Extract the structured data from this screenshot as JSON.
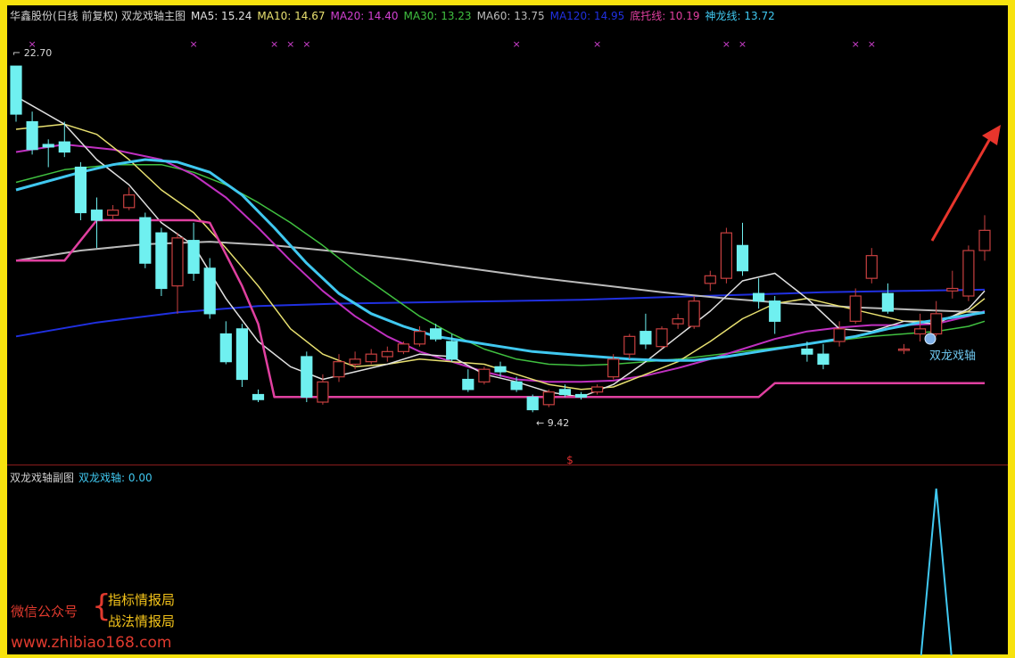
{
  "main_title": {
    "items": [
      {
        "text": "华鑫股份(日线 前复权) 双龙戏轴主图",
        "color": "#d0d0d0"
      },
      {
        "text": "MA5: 15.24",
        "color": "#e0e0e0"
      },
      {
        "text": "MA10: 14.67",
        "color": "#e8e070"
      },
      {
        "text": "MA20: 14.40",
        "color": "#d040d0"
      },
      {
        "text": "MA30: 13.23",
        "color": "#40c040"
      },
      {
        "text": "MA60: 13.75",
        "color": "#bbbbbb"
      },
      {
        "text": "MA120: 14.95",
        "color": "#2030e0"
      },
      {
        "text": "底托线: 10.19",
        "color": "#e040a0"
      },
      {
        "text": "神龙线: 13.72",
        "color": "#40c8f0"
      }
    ]
  },
  "sub_title": {
    "items": [
      {
        "text": "双龙戏轴副图",
        "color": "#d0d0d0"
      },
      {
        "text": "双龙戏轴: 0.00",
        "color": "#40c8f0"
      }
    ]
  },
  "watermark": {
    "label": "微信公众号",
    "line1": "指标情报局",
    "line2": "战法情报局",
    "url": "www.zhibiao168.com"
  },
  "chart_data": {
    "type": "candlestick",
    "price_range": [
      8.8,
      23.2
    ],
    "annotations": {
      "high_label": "22.70",
      "low_label": "9.42",
      "signal_label": "双龙戏轴",
      "axis_marker": "$"
    },
    "colors": {
      "up": "#c84040",
      "down": "#6ff0f0",
      "bottom_line": "#e040a0",
      "dragon_line": "#40c8f0",
      "ma5": "#e0e0e0",
      "ma10": "#e8e070",
      "ma20": "#c030c0",
      "ma30": "#40c040",
      "ma60": "#bbbbbb",
      "ma120": "#2030e0",
      "marker": "#d040d0",
      "arrow": "#e8352c"
    },
    "candles": [
      {
        "o": 22.7,
        "c": 20.8,
        "h": 22.7,
        "l": 20.5
      },
      {
        "o": 20.5,
        "c": 19.4,
        "h": 20.9,
        "l": 19.2
      },
      {
        "o": 19.6,
        "c": 19.5,
        "h": 19.8,
        "l": 18.7
      },
      {
        "o": 19.7,
        "c": 19.3,
        "h": 20.5,
        "l": 19.1
      },
      {
        "o": 18.7,
        "c": 16.9,
        "h": 18.9,
        "l": 16.6
      },
      {
        "o": 17.0,
        "c": 16.6,
        "h": 17.5,
        "l": 15.5
      },
      {
        "o": 16.8,
        "c": 17.0,
        "h": 17.2,
        "l": 16.6
      },
      {
        "o": 17.1,
        "c": 17.6,
        "h": 17.9,
        "l": 17.0
      },
      {
        "o": 16.7,
        "c": 14.9,
        "h": 16.9,
        "l": 14.7
      },
      {
        "o": 16.1,
        "c": 13.9,
        "h": 16.3,
        "l": 13.6
      },
      {
        "o": 14.0,
        "c": 15.9,
        "h": 16.1,
        "l": 12.9
      },
      {
        "o": 15.8,
        "c": 14.5,
        "h": 16.5,
        "l": 14.2
      },
      {
        "o": 14.7,
        "c": 12.9,
        "h": 15.1,
        "l": 12.7
      },
      {
        "o": 12.1,
        "c": 11.0,
        "h": 12.6,
        "l": 10.9
      },
      {
        "o": 12.3,
        "c": 10.3,
        "h": 12.5,
        "l": 10.0
      },
      {
        "o": 9.7,
        "c": 9.5,
        "h": 9.9,
        "l": 9.4
      },
      {
        "o": null,
        "c": null,
        "h": null,
        "l": null
      },
      {
        "o": null,
        "c": null,
        "h": null,
        "l": null
      },
      {
        "o": 11.2,
        "c": 9.6,
        "h": 11.4,
        "l": 9.4
      },
      {
        "o": 9.4,
        "c": 10.2,
        "h": 10.5,
        "l": 9.3
      },
      {
        "o": 10.4,
        "c": 11.0,
        "h": 11.3,
        "l": 10.2
      },
      {
        "o": 10.9,
        "c": 11.1,
        "h": 11.4,
        "l": 10.7
      },
      {
        "o": 11.0,
        "c": 11.3,
        "h": 11.5,
        "l": 10.9
      },
      {
        "o": 11.2,
        "c": 11.4,
        "h": 11.6,
        "l": 11.0
      },
      {
        "o": 11.4,
        "c": 11.7,
        "h": 11.8,
        "l": 11.3
      },
      {
        "o": 11.7,
        "c": 12.2,
        "h": 12.4,
        "l": 11.6
      },
      {
        "o": 12.3,
        "c": 11.9,
        "h": 12.5,
        "l": 11.8
      },
      {
        "o": 11.8,
        "c": 11.1,
        "h": 12.1,
        "l": 11.0
      },
      {
        "o": 10.3,
        "c": 9.9,
        "h": 10.7,
        "l": 9.8
      },
      {
        "o": 10.2,
        "c": 10.7,
        "h": 10.8,
        "l": 10.1
      },
      {
        "o": 10.8,
        "c": 10.6,
        "h": 11.0,
        "l": 10.4
      },
      {
        "o": 10.2,
        "c": 9.9,
        "h": 10.4,
        "l": 9.8
      },
      {
        "o": 9.6,
        "c": 9.1,
        "h": 9.7,
        "l": 9.0
      },
      {
        "o": 9.3,
        "c": 9.8,
        "h": 9.9,
        "l": 9.2
      },
      {
        "o": 9.9,
        "c": 9.7,
        "h": 10.1,
        "l": 9.6
      },
      {
        "o": 9.7,
        "c": 9.6,
        "h": 9.8,
        "l": 9.5
      },
      {
        "o": 9.8,
        "c": 10.0,
        "h": 10.1,
        "l": 9.7
      },
      {
        "o": 10.4,
        "c": 11.1,
        "h": 11.3,
        "l": 10.3
      },
      {
        "o": 11.3,
        "c": 12.0,
        "h": 12.1,
        "l": 11.1
      },
      {
        "o": 12.2,
        "c": 11.7,
        "h": 12.9,
        "l": 11.5
      },
      {
        "o": 11.6,
        "c": 12.3,
        "h": 12.4,
        "l": 11.5
      },
      {
        "o": 12.5,
        "c": 12.7,
        "h": 12.9,
        "l": 12.3
      },
      {
        "o": 12.4,
        "c": 13.4,
        "h": 13.6,
        "l": 12.3
      },
      {
        "o": 14.1,
        "c": 14.4,
        "h": 14.6,
        "l": 13.8
      },
      {
        "o": 14.3,
        "c": 16.1,
        "h": 16.3,
        "l": 14.1
      },
      {
        "o": 15.6,
        "c": 14.6,
        "h": 16.5,
        "l": 14.4
      },
      {
        "o": 13.7,
        "c": 13.4,
        "h": 14.3,
        "l": 13.1
      },
      {
        "o": 13.4,
        "c": 12.6,
        "h": 13.6,
        "l": 12.1
      },
      {
        "o": null,
        "c": null,
        "h": null,
        "l": null
      },
      {
        "o": 11.5,
        "c": 11.3,
        "h": 11.8,
        "l": 11.0
      },
      {
        "o": 11.3,
        "c": 10.9,
        "h": 11.7,
        "l": 10.7
      },
      {
        "o": 11.8,
        "c": 12.3,
        "h": 12.6,
        "l": 11.6
      },
      {
        "o": 12.6,
        "c": 13.6,
        "h": 13.9,
        "l": 12.5
      },
      {
        "o": 14.3,
        "c": 15.2,
        "h": 15.5,
        "l": 14.1
      },
      {
        "o": 13.7,
        "c": 13.0,
        "h": 14.1,
        "l": 12.9
      },
      {
        "o": 11.5,
        "c": 11.5,
        "h": 11.7,
        "l": 11.3
      },
      {
        "o": 12.1,
        "c": 12.3,
        "h": 12.9,
        "l": 11.8
      },
      {
        "o": 12.1,
        "c": 12.9,
        "h": 13.4,
        "l": 12.0
      },
      {
        "o": 13.8,
        "c": 13.9,
        "h": 14.6,
        "l": 13.5
      },
      {
        "o": 13.6,
        "c": 15.4,
        "h": 15.6,
        "l": 13.4
      },
      {
        "o": 15.4,
        "c": 16.2,
        "h": 16.8,
        "l": 15.0
      }
    ],
    "series": {
      "bottom_line": [
        [
          0,
          15.0
        ],
        [
          3,
          15.0
        ],
        [
          5,
          16.6
        ],
        [
          11,
          16.6
        ],
        [
          12,
          16.5
        ],
        [
          14,
          14.0
        ],
        [
          15,
          12.5
        ],
        [
          16,
          9.6
        ],
        [
          46,
          9.6
        ],
        [
          47,
          10.15
        ],
        [
          60,
          10.15
        ]
      ],
      "dragon_line": [
        [
          0,
          17.8
        ],
        [
          4,
          18.5
        ],
        [
          6,
          18.8
        ],
        [
          8,
          19.0
        ],
        [
          10,
          18.9
        ],
        [
          12,
          18.5
        ],
        [
          14,
          17.6
        ],
        [
          16,
          16.3
        ],
        [
          18,
          14.9
        ],
        [
          20,
          13.7
        ],
        [
          22,
          12.9
        ],
        [
          24,
          12.4
        ],
        [
          26,
          12.0
        ],
        [
          28,
          11.8
        ],
        [
          30,
          11.6
        ],
        [
          32,
          11.4
        ],
        [
          34,
          11.3
        ],
        [
          36,
          11.2
        ],
        [
          38,
          11.1
        ],
        [
          40,
          11.05
        ],
        [
          42,
          11.05
        ],
        [
          44,
          11.2
        ],
        [
          46,
          11.4
        ],
        [
          48,
          11.6
        ],
        [
          50,
          11.8
        ],
        [
          52,
          12.0
        ],
        [
          54,
          12.3
        ],
        [
          56,
          12.55
        ],
        [
          58,
          12.75
        ],
        [
          60,
          12.95
        ]
      ],
      "ma5": [
        [
          0,
          21.5
        ],
        [
          3,
          20.4
        ],
        [
          5,
          19.0
        ],
        [
          7,
          18.0
        ],
        [
          9,
          16.5
        ],
        [
          11,
          15.6
        ],
        [
          13,
          13.5
        ],
        [
          15,
          11.8
        ],
        [
          17,
          10.8
        ],
        [
          19,
          10.3
        ],
        [
          21,
          10.6
        ],
        [
          23,
          10.9
        ],
        [
          25,
          11.3
        ],
        [
          27,
          11.2
        ],
        [
          29,
          10.5
        ],
        [
          31,
          10.2
        ],
        [
          33,
          9.8
        ],
        [
          35,
          9.6
        ],
        [
          37,
          10.1
        ],
        [
          39,
          11.0
        ],
        [
          41,
          12.0
        ],
        [
          43,
          13.0
        ],
        [
          45,
          14.2
        ],
        [
          47,
          14.5
        ],
        [
          49,
          13.5
        ],
        [
          51,
          12.3
        ],
        [
          53,
          12.2
        ],
        [
          55,
          12.6
        ],
        [
          57,
          12.5
        ],
        [
          59,
          13.1
        ],
        [
          60,
          13.8
        ]
      ],
      "ma10": [
        [
          0,
          20.2
        ],
        [
          3,
          20.4
        ],
        [
          5,
          20.0
        ],
        [
          7,
          19.0
        ],
        [
          9,
          17.8
        ],
        [
          11,
          16.9
        ],
        [
          13,
          15.5
        ],
        [
          15,
          14.0
        ],
        [
          17,
          12.3
        ],
        [
          19,
          11.3
        ],
        [
          21,
          10.8
        ],
        [
          23,
          10.9
        ],
        [
          25,
          11.1
        ],
        [
          27,
          11.0
        ],
        [
          29,
          10.9
        ],
        [
          31,
          10.5
        ],
        [
          33,
          10.1
        ],
        [
          35,
          9.9
        ],
        [
          37,
          10.0
        ],
        [
          39,
          10.5
        ],
        [
          41,
          11.0
        ],
        [
          43,
          11.8
        ],
        [
          45,
          12.7
        ],
        [
          47,
          13.3
        ],
        [
          49,
          13.5
        ],
        [
          51,
          13.2
        ],
        [
          53,
          12.9
        ],
        [
          55,
          12.6
        ],
        [
          57,
          12.6
        ],
        [
          59,
          13.0
        ],
        [
          60,
          13.5
        ]
      ],
      "ma20": [
        [
          0,
          19.3
        ],
        [
          3,
          19.6
        ],
        [
          6,
          19.4
        ],
        [
          9,
          19.0
        ],
        [
          11,
          18.4
        ],
        [
          13,
          17.5
        ],
        [
          15,
          16.3
        ],
        [
          17,
          15.0
        ],
        [
          19,
          13.8
        ],
        [
          21,
          12.8
        ],
        [
          23,
          12.0
        ],
        [
          25,
          11.4
        ],
        [
          27,
          11.0
        ],
        [
          29,
          10.6
        ],
        [
          31,
          10.3
        ],
        [
          33,
          10.2
        ],
        [
          35,
          10.2
        ],
        [
          37,
          10.25
        ],
        [
          39,
          10.45
        ],
        [
          41,
          10.75
        ],
        [
          43,
          11.1
        ],
        [
          45,
          11.5
        ],
        [
          47,
          11.9
        ],
        [
          49,
          12.2
        ],
        [
          51,
          12.35
        ],
        [
          53,
          12.45
        ],
        [
          55,
          12.45
        ],
        [
          57,
          12.5
        ],
        [
          59,
          12.8
        ],
        [
          60,
          13.0
        ]
      ],
      "ma30": [
        [
          0,
          18.1
        ],
        [
          3,
          18.6
        ],
        [
          6,
          18.8
        ],
        [
          9,
          18.8
        ],
        [
          11,
          18.5
        ],
        [
          13,
          18.0
        ],
        [
          15,
          17.3
        ],
        [
          17,
          16.5
        ],
        [
          19,
          15.6
        ],
        [
          21,
          14.6
        ],
        [
          23,
          13.7
        ],
        [
          25,
          12.8
        ],
        [
          27,
          12.1
        ],
        [
          29,
          11.5
        ],
        [
          31,
          11.1
        ],
        [
          33,
          10.9
        ],
        [
          35,
          10.85
        ],
        [
          37,
          10.9
        ],
        [
          39,
          11.0
        ],
        [
          41,
          11.1
        ],
        [
          43,
          11.25
        ],
        [
          45,
          11.4
        ],
        [
          47,
          11.55
        ],
        [
          49,
          11.7
        ],
        [
          51,
          11.85
        ],
        [
          53,
          12.0
        ],
        [
          55,
          12.1
        ],
        [
          57,
          12.2
        ],
        [
          59,
          12.4
        ],
        [
          60,
          12.6
        ]
      ],
      "ma60": [
        [
          0,
          15.0
        ],
        [
          4,
          15.4
        ],
        [
          8,
          15.65
        ],
        [
          12,
          15.75
        ],
        [
          16,
          15.6
        ],
        [
          20,
          15.35
        ],
        [
          24,
          15.05
        ],
        [
          28,
          14.7
        ],
        [
          32,
          14.35
        ],
        [
          36,
          14.05
        ],
        [
          40,
          13.75
        ],
        [
          44,
          13.5
        ],
        [
          48,
          13.3
        ],
        [
          52,
          13.15
        ],
        [
          56,
          13.05
        ],
        [
          60,
          12.95
        ]
      ],
      "ma120": [
        [
          0,
          12.0
        ],
        [
          5,
          12.55
        ],
        [
          10,
          12.95
        ],
        [
          15,
          13.2
        ],
        [
          20,
          13.3
        ],
        [
          25,
          13.35
        ],
        [
          30,
          13.4
        ],
        [
          35,
          13.45
        ],
        [
          40,
          13.55
        ],
        [
          45,
          13.65
        ],
        [
          50,
          13.75
        ],
        [
          55,
          13.8
        ],
        [
          60,
          13.85
        ]
      ]
    },
    "magenta_markers": [
      1,
      11,
      16,
      17,
      18,
      31,
      36,
      44,
      45,
      52,
      53
    ],
    "sub_chart": {
      "name": "双龙戏轴",
      "value_range": [
        0,
        1
      ],
      "spikes": [
        57
      ]
    }
  }
}
